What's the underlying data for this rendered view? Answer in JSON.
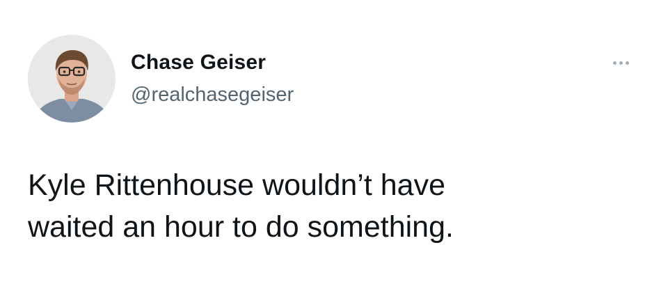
{
  "tweet": {
    "author": {
      "display_name": "Chase Geiser",
      "handle": "@realchasegeiser",
      "avatar_icon": "profile-photo"
    },
    "more_icon": "more-horizontal-icon",
    "text_lines": [
      "Kyle Rittenhouse wouldn’t have",
      "waited an hour to do something."
    ]
  },
  "colors": {
    "background": "#ffffff",
    "primary_text": "#0f1419",
    "secondary_text": "#536471",
    "icon_gray": "#a3adb6"
  }
}
